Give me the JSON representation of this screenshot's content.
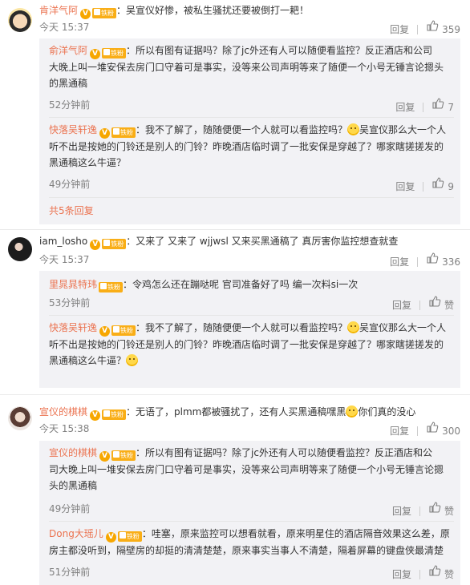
{
  "actions": {
    "reply": "回复",
    "like": "赞"
  },
  "comments": [
    {
      "user": "肯洋气阿",
      "text": "：吴宣仪好惨，被私生骚扰还要被倒打一耙！",
      "time": "今天 15:37",
      "likes": "359",
      "replies": [
        {
          "user": "俞洋气阿",
          "text1": "：所以有图有证据吗？除了jc外还有人可以随便看监控？反正酒店和公司",
          "text2": "大晚上叫一堆安保去房门口守着可是事实，没等来公司声明等来了随便一个小号无锤言论摁头",
          "text3": "的黑通稿",
          "time": "52分钟前",
          "likes": "7"
        },
        {
          "user": "快落吴轩逸",
          "text1": "：我不了解了，随随便便一个人就可以看监控吗？",
          "text1b": "吴宣仪那么大一个人",
          "text2": "听不出是按她的门铃还是别人的门铃？昨晚酒店临时调了一批安保是穿越了？哪家瞎搓搓发的",
          "text3": "黑通稿这么牛逼？",
          "time": "49分钟前",
          "likes": "9"
        }
      ],
      "more": "共5条回复"
    },
    {
      "user": "iam_losho",
      "text": "：又来了 又来了 wjjwsl 又来买黑通稿了 真厉害你监控想查就查",
      "time": "今天 15:37",
      "likes": "336",
      "replies": [
        {
          "user": "里晁晁特玮",
          "text1": "：令鸡怎么还在蹦哒呢 官司准备好了吗 编一次料si一次",
          "time": "53分钟前",
          "likes": "赞"
        },
        {
          "user": "快落吴轩逸",
          "text1": "：我不了解了，随随便便一个人就可以看监控吗？",
          "text1b": "吴宣仪那么大一个人",
          "text2": "听不出是按她的门铃还是别人的门铃？昨晚酒店临时调了一批安保是穿越了？哪家瞎搓搓发的",
          "text3": "黑通稿这么牛逼？",
          "time": "49分钟前",
          "likes": "赞"
        }
      ]
    },
    {
      "user": "宣仪的棋棋",
      "text": "：无语了，plmm都被骚扰了，还有人买黑通稿嘿黑",
      "text_b": "你们真的没心",
      "time": "今天 15:38",
      "likes": "300",
      "replies": [
        {
          "user": "宣仪的棋棋",
          "text1": "：所以有图有证据吗？除了jc外还有人可以随便看监控？反正酒店和公",
          "text2": "司大晚上叫一堆安保去房门口守着可是事实，没等来公司声明等来了随便一个小号无锤言论摁",
          "text3": "头的黑通稿",
          "time": "49分钟前",
          "likes": "赞"
        },
        {
          "user": "Dong大瑶儿",
          "text1": "：哇塞，原来监控可以想看就看，原来明星住的酒店隔音效果这么差，原",
          "text2": "房主都没听到，隔壁房的却挺的清清楚楚，原来事实当事人不清楚，隔着屏幕的键盘侠最清楚",
          "time": "51分钟前",
          "likes": "赞"
        }
      ]
    }
  ]
}
